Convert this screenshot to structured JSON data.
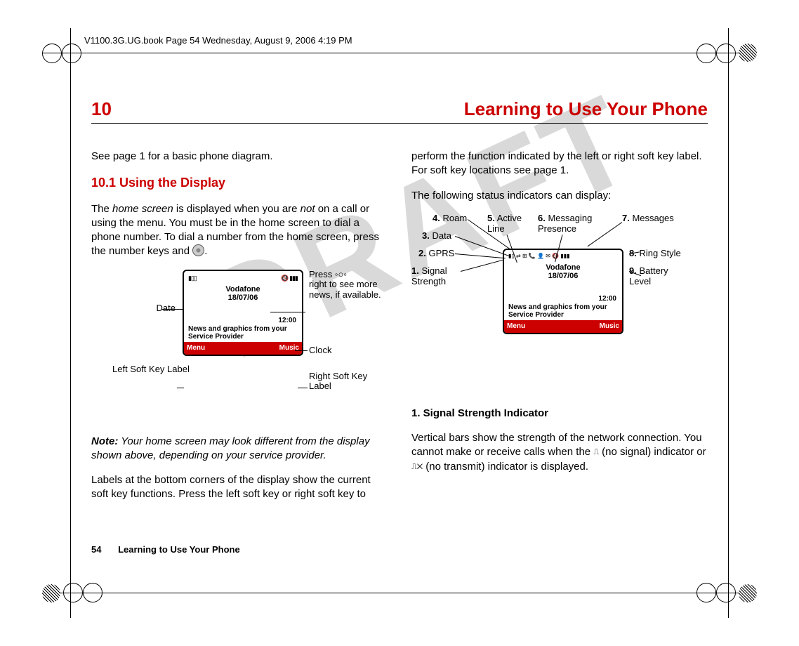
{
  "meta": {
    "header": "V1100.3G.UG.book  Page 54  Wednesday, August 9, 2006  4:19 PM",
    "watermark": "DRAFT"
  },
  "chapter": {
    "number": "10",
    "title": "Learning to Use Your Phone"
  },
  "left": {
    "intro": "See page 1 for a basic phone diagram.",
    "section_num_title": "10.1 Using the Display",
    "para1a": "The ",
    "para1b": "home screen",
    "para1c": " is displayed when you are ",
    "para1d": "not",
    "para1e": " on a call or using the menu. You must be in the home screen to dial a phone number. To dial a number from the home screen, press the number keys and ",
    "para1f": ".",
    "callouts": {
      "date": "Date",
      "leftsoft": "Left Soft Key Label",
      "press": "Press",
      "press2": "right to see more news, if available.",
      "clock": "Clock",
      "rightsoft": "Right Soft Key Label"
    },
    "note_label": "Note:",
    "note_text": " Your home screen may look different from the display shown above, depending on your service provider.",
    "para2": "Labels at the bottom corners of the display show the current soft key functions. Press the left soft key or right soft key to"
  },
  "right": {
    "para1": "perform the function indicated by the left or right soft key label. For soft key locations see page 1.",
    "para2": "The following status indicators can display:",
    "indicators": {
      "i1": "1.",
      "i1t": "Signal Strength",
      "i2": "2.",
      "i2t": "GPRS",
      "i3": "3.",
      "i3t": "Data",
      "i4": "4.",
      "i4t": "Roam",
      "i5": "5.",
      "i5t": "Active Line",
      "i6": "6.",
      "i6t": "Messaging Presence",
      "i7": "7.",
      "i7t": "Messages",
      "i8": "8.",
      "i8t": "Ring Style",
      "i9": "9.",
      "i9t": "Battery Level"
    },
    "sig_head": "1. Signal Strength Indicator",
    "sig_body1": "Vertical bars show the strength of the network connection. You cannot make or receive calls when the ",
    "sig_body2": " (no signal) indicator or ",
    "sig_body3": " (no transmit) indicator is displayed."
  },
  "phone": {
    "carrier": "Vodafone",
    "date": "18/07/06",
    "time": "12:00",
    "news": "News and graphics from your Service Provider",
    "menu": "Menu",
    "music": "Music",
    "status_left": "▮▯▯",
    "status_right": "🔇 ▮▮▮",
    "status_full": "▮▯ ⇄ ⊞ 📞 👤 ✉ 🔇 ▮▮▮"
  },
  "footer": {
    "page": "54",
    "title": "Learning to Use Your Phone"
  }
}
